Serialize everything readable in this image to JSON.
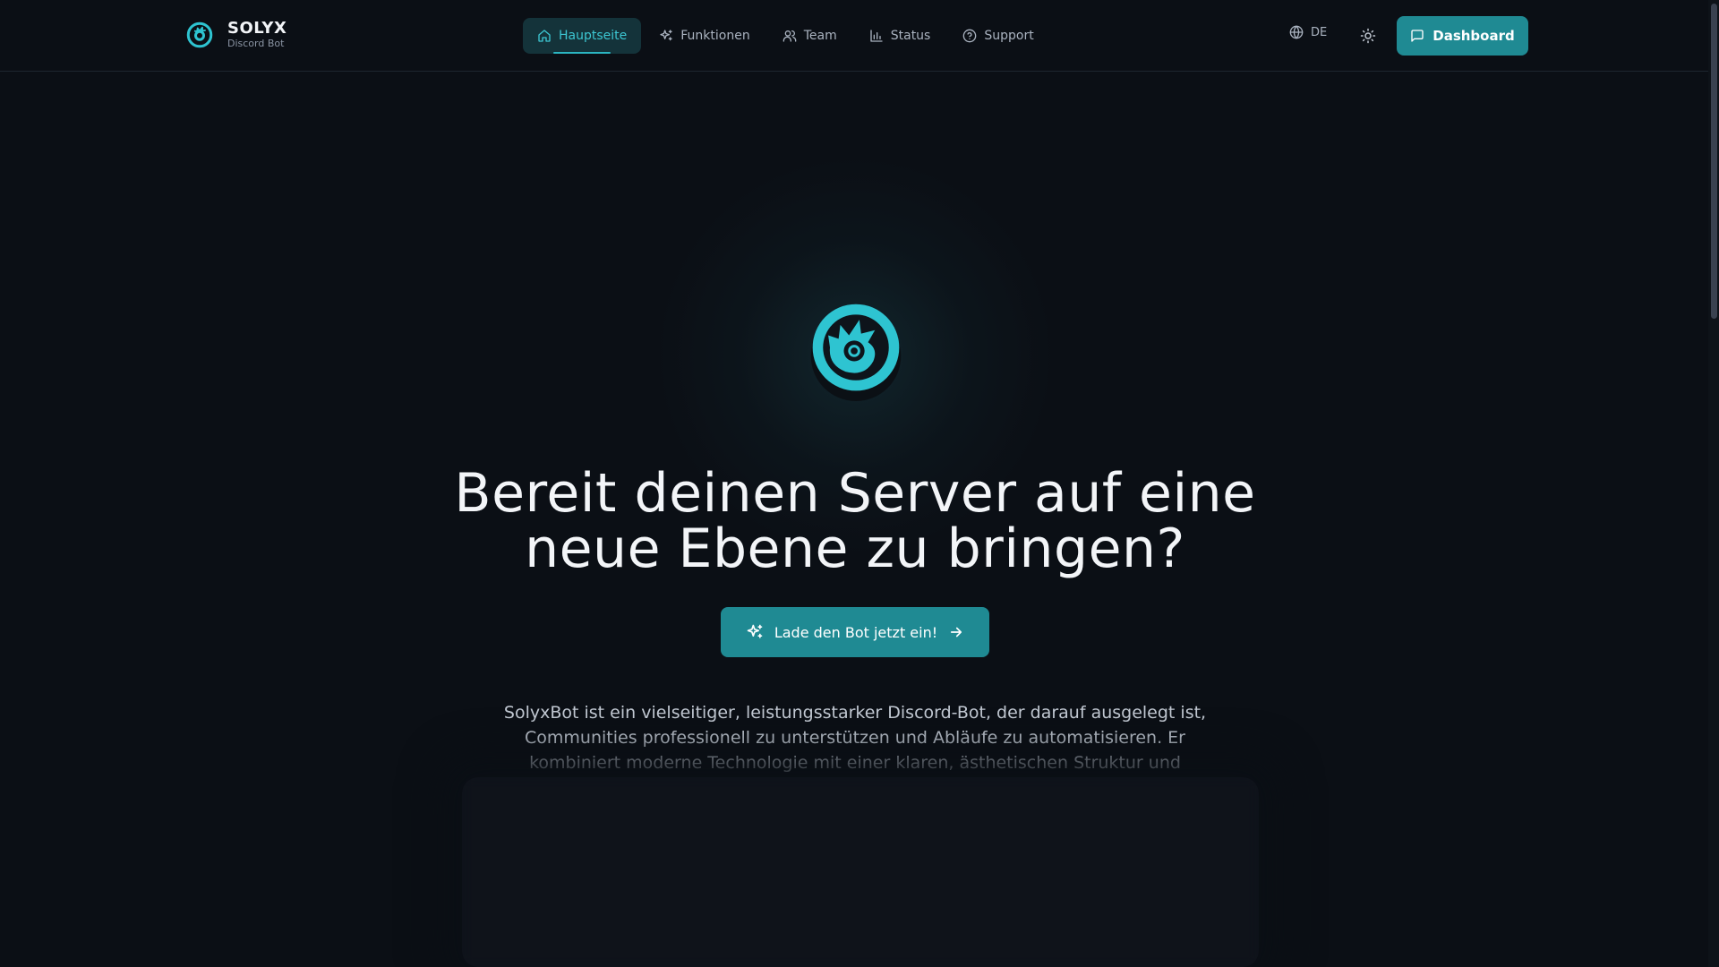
{
  "brand": {
    "title": "SOLYX",
    "subtitle": "Discord Bot",
    "icon": "solyx-logo-icon"
  },
  "nav": {
    "items": [
      {
        "label": "Hauptseite",
        "icon": "home-icon",
        "active": true
      },
      {
        "label": "Funktionen",
        "icon": "sparkles-icon",
        "active": false
      },
      {
        "label": "Team",
        "icon": "users-icon",
        "active": false
      },
      {
        "label": "Status",
        "icon": "bar-chart-icon",
        "active": false
      },
      {
        "label": "Support",
        "icon": "help-circle-icon",
        "active": false
      }
    ]
  },
  "header_actions": {
    "language": "DE",
    "language_icon": "globe-icon",
    "theme_icon": "sun-icon",
    "dashboard_label": "Dashboard",
    "dashboard_icon": "message-square-icon"
  },
  "hero": {
    "title_line1": "Bereit deinen Server auf eine",
    "title_line2": "neue Ebene zu bringen?",
    "cta_label": "Lade den Bot jetzt ein!",
    "description_visible": "SolyxBot ist ein vielseitiger, leistungsstarker Discord-Bot, der darauf ausgelegt ist, Communities professionell zu unterstützen und Abläufe zu automatisieren. Er kombiniert moderne Technologie mit einer klaren, ästhetischen Struktur und"
  },
  "colors": {
    "background": "#0b0f15",
    "accent": "#1f8a93",
    "accent_light": "#2ec4d1",
    "active_nav_bg": "#14333a",
    "text_primary": "#f3f5f8",
    "text_muted": "#aab3c0"
  }
}
